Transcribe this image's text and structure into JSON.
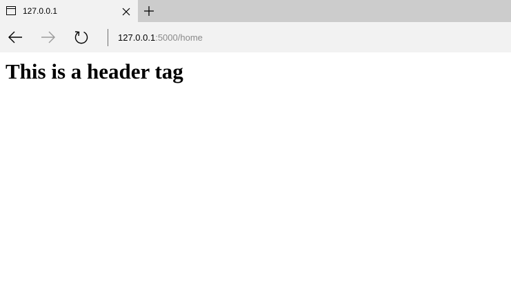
{
  "browser": {
    "tab": {
      "title": "127.0.0.1",
      "icon": "tab-page-icon",
      "close_icon": "close-icon"
    },
    "new_tab_icon": "plus-icon",
    "nav": {
      "back_icon": "arrow-left-icon",
      "forward_icon": "arrow-right-icon",
      "refresh_icon": "refresh-icon"
    },
    "address": {
      "host": "127.0.0.1",
      "path": ":5000/home"
    },
    "colors": {
      "tab_strip": "#cccccc",
      "active_tab": "#f2f2f2",
      "nav_bar": "#f2f2f2",
      "address_path": "#8a8a8a"
    }
  },
  "page": {
    "heading": "This is a header tag"
  }
}
